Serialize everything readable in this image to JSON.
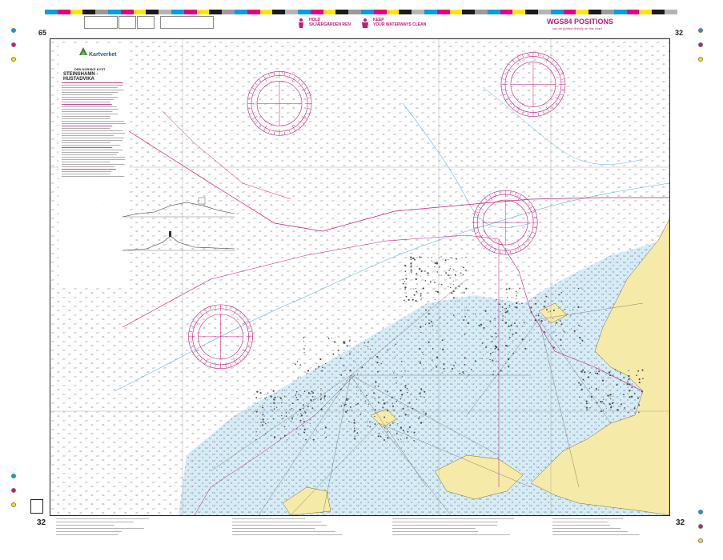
{
  "chart_number": "32",
  "side_number": "65",
  "colorbar": [
    "#00a0e0",
    "#e6007e",
    "#ffe600",
    "#1a1a1a",
    "#9a9a9a",
    "#00a0e0",
    "#e6007e",
    "#ffe600",
    "#1a1a1a",
    "#b5b5b5",
    "#00a0e0",
    "#e6007e",
    "#ffe600",
    "#1a1a1a",
    "#9a9a9a",
    "#00a0e0",
    "#e6007e",
    "#ffe600",
    "#1a1a1a",
    "#b5b5b5",
    "#00a0e0",
    "#e6007e",
    "#ffe600",
    "#1a1a1a",
    "#9a9a9a",
    "#00a0e0",
    "#e6007e",
    "#ffe600",
    "#1a1a1a",
    "#b5b5b5",
    "#00a0e0",
    "#e6007e",
    "#ffe600",
    "#1a1a1a",
    "#9a9a9a",
    "#00a0e0",
    "#e6007e",
    "#ffe600",
    "#1a1a1a",
    "#b5b5b5",
    "#00a0e0",
    "#e6007e",
    "#ffe600",
    "#1a1a1a",
    "#9a9a9a",
    "#00a0e0",
    "#e6007e",
    "#ffe600",
    "#1a1a1a",
    "#b5b5b5"
  ],
  "header": {
    "hold_line1": "HOLD",
    "hold_line2": "SKJÆRGÅRDEN REN",
    "keep_line1": "KEEP",
    "keep_line2": "YOUR WATERWAYS CLEAN",
    "wgs_title": "WGS84 POSITIONS",
    "wgs_sub": "can be plotted directly on this chart"
  },
  "title_block": {
    "logo_text": "Kartverket",
    "series": "DEN NORSKE KYST",
    "title": "STEINSHAMN - HUSTADVIKA"
  },
  "colors": {
    "land": "#f6eaa8",
    "shallow": "#cfe9f6",
    "magenta": "#c2187a",
    "frame": "#222222",
    "sounding": "#8a8a8a"
  },
  "compass_roses": [
    {
      "cx_frac": 0.37,
      "cy_frac": 0.135
    },
    {
      "cx_frac": 0.78,
      "cy_frac": 0.095
    },
    {
      "cx_frac": 0.735,
      "cy_frac": 0.385
    },
    {
      "cx_frac": 0.275,
      "cy_frac": 0.625
    }
  ],
  "footer": {
    "left_number": "32",
    "right_number": "32"
  }
}
